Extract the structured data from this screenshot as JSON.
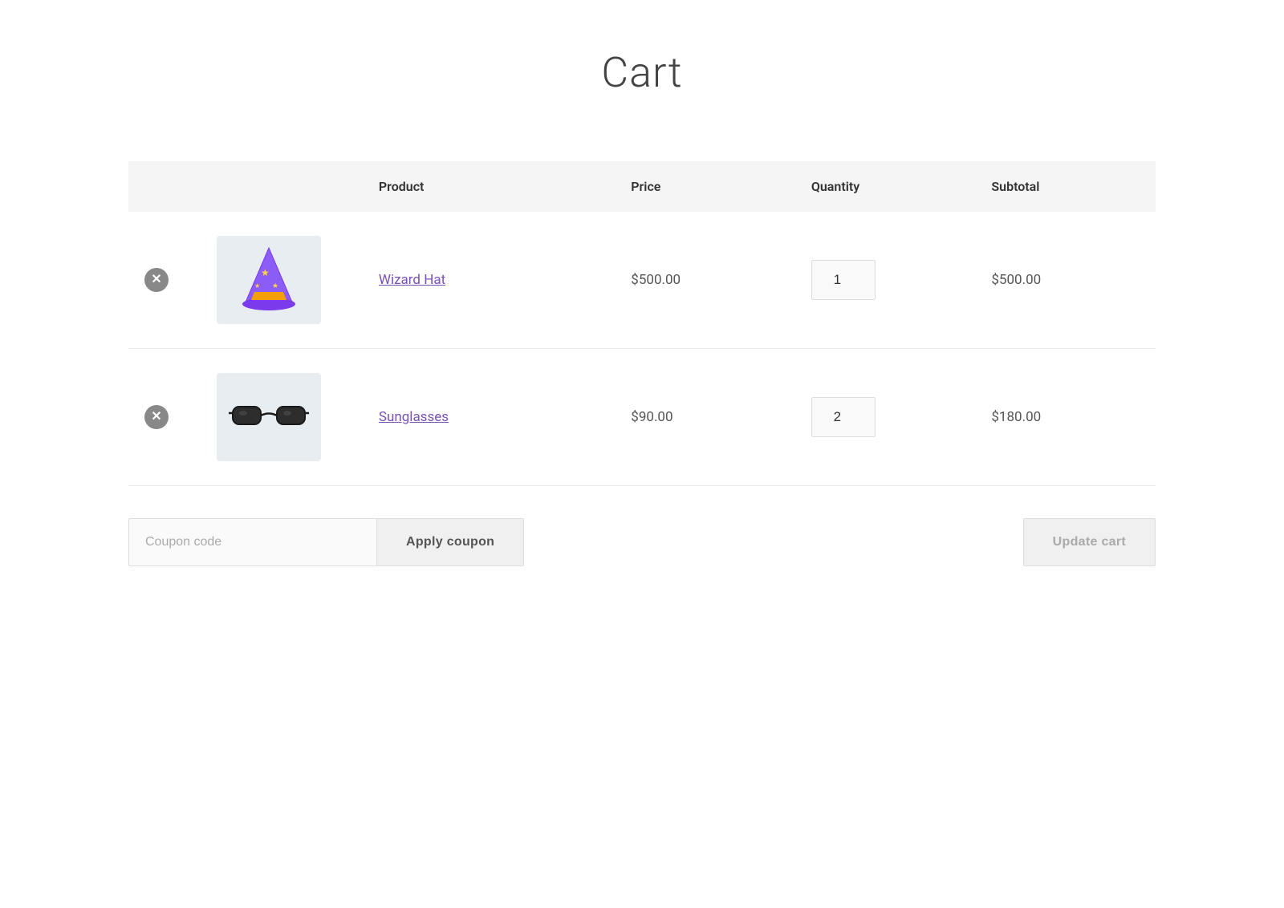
{
  "page": {
    "title": "Cart"
  },
  "table": {
    "headers": {
      "remove": "",
      "image": "",
      "product": "Product",
      "price": "Price",
      "quantity": "Quantity",
      "subtotal": "Subtotal"
    },
    "rows": [
      {
        "id": "wizard-hat",
        "product_name": "Wizard Hat",
        "price": "$500.00",
        "quantity": 1,
        "subtotal": "$500.00",
        "image_label": "wizard-hat-image"
      },
      {
        "id": "sunglasses",
        "product_name": "Sunglasses",
        "price": "$90.00",
        "quantity": 2,
        "subtotal": "$180.00",
        "image_label": "sunglasses-image"
      }
    ]
  },
  "actions": {
    "coupon_placeholder": "Coupon code",
    "coupon_value": "",
    "apply_coupon_label": "Apply coupon",
    "update_cart_label": "Update cart"
  }
}
